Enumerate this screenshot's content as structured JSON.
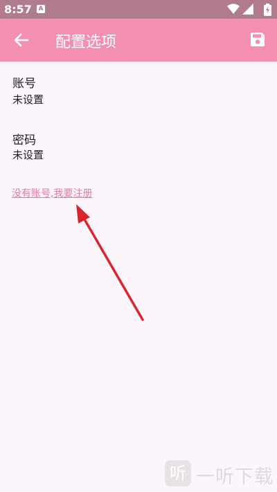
{
  "status_bar": {
    "time": "8:57",
    "notification_glyph": "A",
    "icons": [
      "wifi-icon",
      "signal-icon",
      "battery-charging-icon"
    ]
  },
  "app_bar": {
    "title": "配置选项",
    "back_icon": "arrow-left-icon",
    "save_icon": "floppy-disk-icon",
    "background": "#F48FB1"
  },
  "form": {
    "account_label": "账号",
    "account_value": "未设置",
    "password_label": "密码",
    "password_value": "未设置"
  },
  "register_link": {
    "text": "没有账号,我要注册",
    "color": "#E27A9D"
  },
  "annotation": {
    "icon": "red-arrow-annotation",
    "color": "#D9252A"
  },
  "watermark": {
    "logo_glyph": "听",
    "text": "一听下载"
  }
}
